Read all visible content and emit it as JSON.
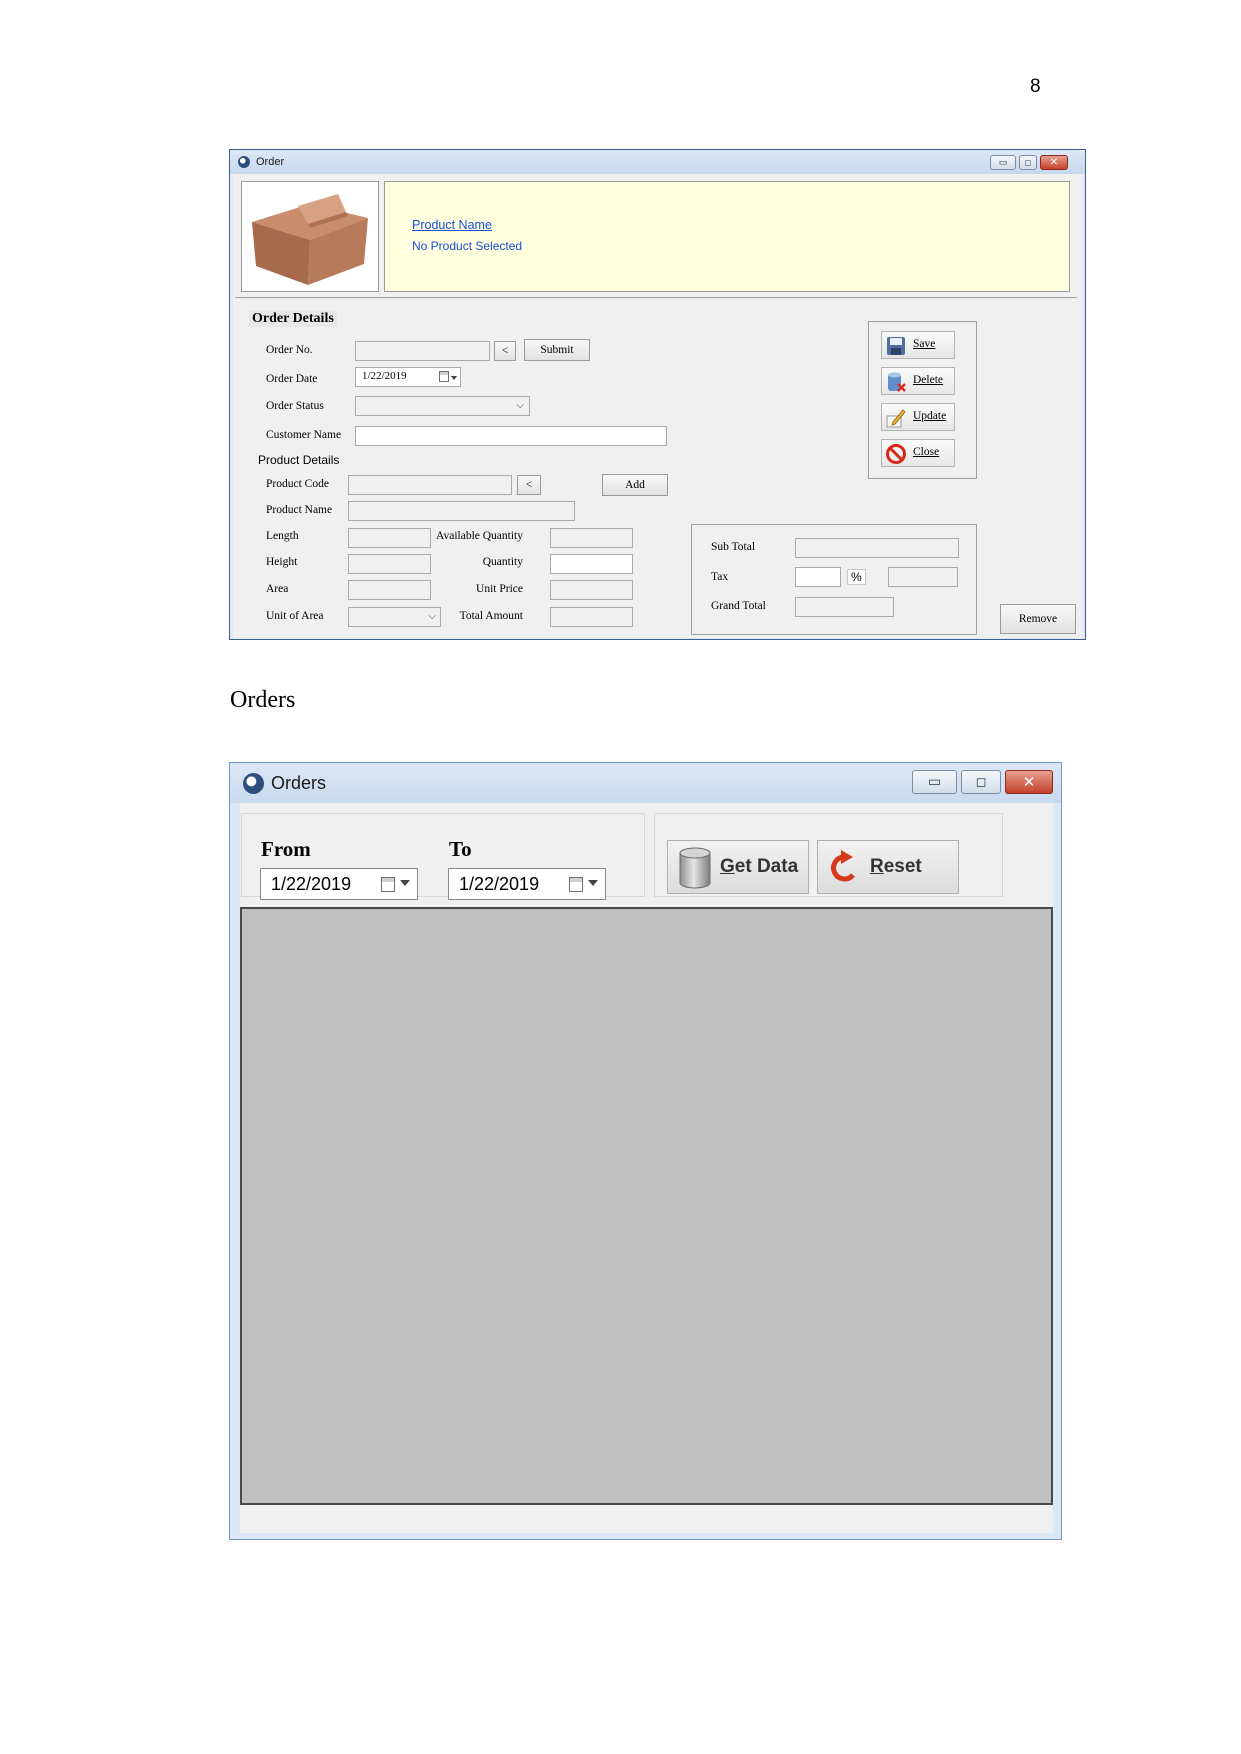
{
  "page_number": "8",
  "caption": "Orders",
  "order_window": {
    "title": "Order",
    "product_info": {
      "name_link": "Product Name",
      "status": "No Product Selected"
    },
    "order_details": {
      "group_title": "Order Details",
      "order_no_label": "Order No.",
      "lookup_button": "<",
      "submit_button": "Submit",
      "order_date_label": "Order Date",
      "order_date_value": "1/22/2019",
      "order_status_label": "Order Status",
      "customer_name_label": "Customer Name"
    },
    "product_details": {
      "group_title": "Product Details",
      "product_code_label": "Product Code",
      "lookup_button": "<",
      "add_button": "Add",
      "product_name_label": "Product Name",
      "length_label": "Length",
      "height_label": "Height",
      "area_label": "Area",
      "unit_of_area_label": "Unit of Area",
      "available_quantity_label": "Available Quantity",
      "quantity_label": "Quantity",
      "unit_price_label": "Unit Price",
      "total_amount_label": "Total Amount"
    },
    "totals": {
      "sub_total_label": "Sub Total",
      "tax_label": "Tax",
      "percent_label": "%",
      "grand_total_label": "Grand Total"
    },
    "actions": {
      "save": "Save",
      "delete": "Delete",
      "update": "Update",
      "close": "Close",
      "remove": "Remove"
    }
  },
  "orders_window": {
    "title": "Orders",
    "from_label": "From",
    "from_value": "1/22/2019",
    "to_label": "To",
    "to_value": "1/22/2019",
    "get_data_button": "Get Data",
    "reset_button": "Reset"
  },
  "colors": {
    "product_panel_bg": "#ffffe0",
    "link_blue": "#1a4fd6",
    "grid_bg": "#c0c0c0",
    "reset_red": "#d43a1a"
  }
}
